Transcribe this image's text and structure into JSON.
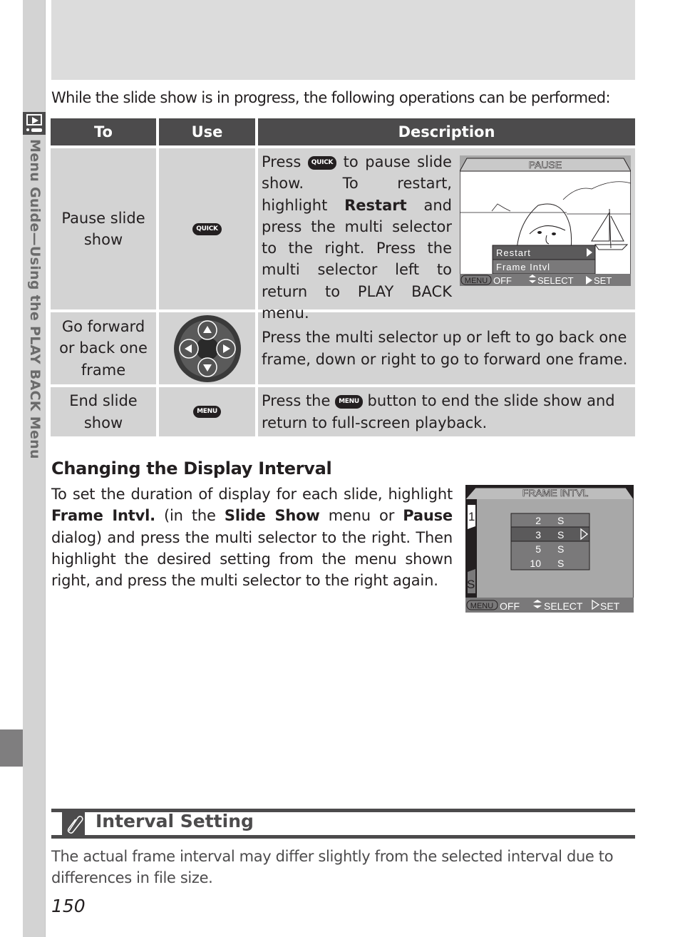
{
  "sidebar": {
    "section_label": "Menu Guide—Using the PLAY BACK Menu",
    "section_icon": "playback-icon"
  },
  "intro": "While the slide show is in progress, the following operations can be performed:",
  "table": {
    "headers": [
      "To",
      "Use",
      "Description"
    ],
    "rows": [
      {
        "to": "Pause slide show",
        "use_icon": "quick-button-icon",
        "use_label": "QUICK",
        "description": {
          "pre": "Press",
          "button": "QUICK",
          "after_button": "to pause slide show. To restart, highlight",
          "bold": "Restart",
          "rest": "and press the multi selector to the right. Press the multi selector left to return to PLAY BACK menu."
        },
        "screen": {
          "title": "PAUSE",
          "menu_items": [
            "Restart",
            "Frame Intvl"
          ],
          "footer": {
            "menu": "MENU",
            "off": "OFF",
            "select": "SELECT",
            "set": "SET"
          }
        }
      },
      {
        "to": "Go forward or back one frame",
        "use_icon": "multi-selector-icon",
        "description": "Press the multi selector up or left to go back one frame, down or right to go to forward one frame."
      },
      {
        "to": "End slide show",
        "use_icon": "menu-button-icon",
        "use_label": "MENU",
        "description": {
          "pre": "Press the",
          "button": "MENU",
          "rest": "button to end the slide show and return to full-screen playback."
        }
      }
    ]
  },
  "section": {
    "title": "Changing the Display Interval",
    "para": {
      "t1": "To set the duration of display for each slide, highlight",
      "b1": "Frame Intvl.",
      "t2": "(in the",
      "b2": "Slide Show",
      "t3": "menu or",
      "b3": "Pause",
      "t4": "dialog) and press the multi selector to the right. Then highlight the desired setting from the menu shown right, and press the multi selector to the right again."
    },
    "screen": {
      "title": "FRAME INTVL",
      "tab_top": "1",
      "tab_bottom": "S",
      "options": [
        {
          "value": "2",
          "unit": "S",
          "selected": false
        },
        {
          "value": "3",
          "unit": "S",
          "selected": true
        },
        {
          "value": "5",
          "unit": "S",
          "selected": false
        },
        {
          "value": "10",
          "unit": "S",
          "selected": false
        }
      ],
      "footer": {
        "menu": "MENU",
        "off": "OFF",
        "select": "SELECT",
        "set": "SET"
      }
    }
  },
  "note": {
    "icon": "paperclip-icon",
    "title": "Interval Setting",
    "text": "The actual frame interval may differ slightly from the selected interval due to differences in file size."
  },
  "page_number": "150"
}
